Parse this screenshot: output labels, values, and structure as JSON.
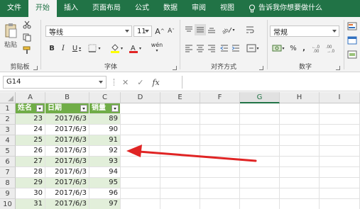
{
  "menu": {
    "items": [
      "文件",
      "开始",
      "插入",
      "页面布局",
      "公式",
      "数据",
      "审阅",
      "视图"
    ],
    "active_index": 1,
    "help_text": "告诉我你想要做什么"
  },
  "ribbon": {
    "clipboard": {
      "label": "剪贴板",
      "paste_label": "粘贴"
    },
    "font": {
      "label": "字体",
      "font_name": "等线",
      "font_size": "11",
      "bold": "B",
      "italic": "I",
      "underline": "U",
      "grow": "A",
      "shrink": "A",
      "phonetic": "wén"
    },
    "alignment": {
      "label": "对齐方式"
    },
    "number": {
      "label": "数字",
      "format": "常规",
      "percent": "%",
      "comma": ",",
      "inc_decimal": ".00→.0",
      "dec_decimal": ".0→.00"
    }
  },
  "formula_bar": {
    "name_box": "G14",
    "fx": "fx",
    "cancel": "✕",
    "enter": "✓",
    "content": ""
  },
  "sheet": {
    "columns": [
      "A",
      "B",
      "C",
      "D",
      "E",
      "F",
      "G",
      "H",
      "I"
    ],
    "selected_column": "G",
    "row_numbers": [
      "1",
      "2",
      "3",
      "4",
      "5",
      "6",
      "7",
      "8",
      "9",
      "10"
    ],
    "table_headers": [
      "姓名",
      "日期",
      "销量"
    ],
    "rows": [
      [
        "23",
        "2017/6/3",
        "89"
      ],
      [
        "24",
        "2017/6/3",
        "90"
      ],
      [
        "25",
        "2017/6/3",
        "91"
      ],
      [
        "26",
        "2017/6/3",
        "92"
      ],
      [
        "27",
        "2017/6/3",
        "93"
      ],
      [
        "28",
        "2017/6/3",
        "94"
      ],
      [
        "29",
        "2017/6/3",
        "95"
      ],
      [
        "30",
        "2017/6/3",
        "96"
      ],
      [
        "31",
        "2017/6/3",
        "97"
      ]
    ]
  },
  "colors": {
    "brand": "#217346",
    "table_header": "#70ad47",
    "table_band": "#e2efda",
    "annotation_arrow": "#e02424"
  }
}
